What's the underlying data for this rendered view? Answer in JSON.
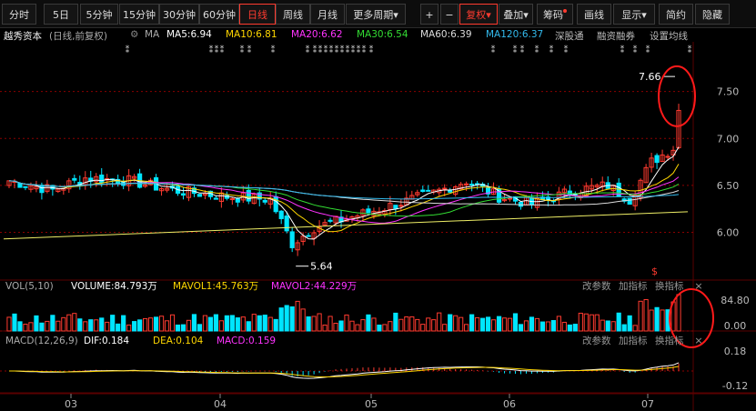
{
  "toolbar": {
    "periods": [
      "分时",
      "5日",
      "5分钟",
      "15分钟",
      "30分钟",
      "60分钟",
      "日线",
      "周线",
      "月线",
      "更多周期"
    ],
    "more_arrow": "▾",
    "plus": "+",
    "minus": "−",
    "right_buttons": [
      "复权",
      "叠加",
      "筹码",
      "画线",
      "显示",
      "简约",
      "隐藏"
    ],
    "fq_arrow": "▾",
    "overlay_arrow": "▾",
    "show_arrow": "▾"
  },
  "stock": {
    "name": "越秀资本",
    "mode": "(日线,前复权)",
    "gear": "⚙",
    "ma_label": "MA",
    "ma_lines": [
      {
        "text": "MA5:6.94",
        "color": "#ffffff"
      },
      {
        "text": "MA10:6.81",
        "color": "#ffd700"
      },
      {
        "text": "MA20:6.62",
        "color": "#ff33ff"
      },
      {
        "text": "MA30:6.54",
        "color": "#33dd33"
      },
      {
        "text": "MA60:6.39",
        "color": "#dddddd"
      },
      {
        "text": "MA120:6.37",
        "color": "#33bbee"
      }
    ],
    "tags": [
      "深股通",
      "融资融券",
      "设置均线"
    ]
  },
  "price_axis": [
    "7.50",
    "7.00",
    "6.50",
    "6.00"
  ],
  "annotations": {
    "high": "7.66",
    "low": "5.64"
  },
  "vol_panel": {
    "label": "VOL(5,10)",
    "volume": "VOLUME:84.793万",
    "mavol1": "MAVOL1:45.763万",
    "mavol2": "MAVOL2:44.229万",
    "axis": [
      "84.80",
      "0.00"
    ],
    "params": "改参数",
    "add": "加指标",
    "swap": "换指标",
    "close": "×"
  },
  "macd_panel": {
    "label": "MACD(12,26,9)",
    "dif": "DIF:0.184",
    "dea": "DEA:0.104",
    "macd": "MACD:0.159",
    "axis": [
      "0.18",
      "-0.12"
    ],
    "params": "改参数",
    "add": "加指标",
    "swap": "换指标",
    "close": "×"
  },
  "months": [
    "03",
    "04",
    "05",
    "06",
    "07"
  ],
  "dollar_mark": "$",
  "colors": {
    "up": "#ff3b30",
    "down": "#00e5ff",
    "ma5": "#ffffff",
    "ma10": "#ffd700",
    "ma20": "#ff33ff",
    "ma30": "#33dd33",
    "ma60": "#dddddd",
    "ma120": "#33bbee",
    "grid": "#8b0000"
  }
}
